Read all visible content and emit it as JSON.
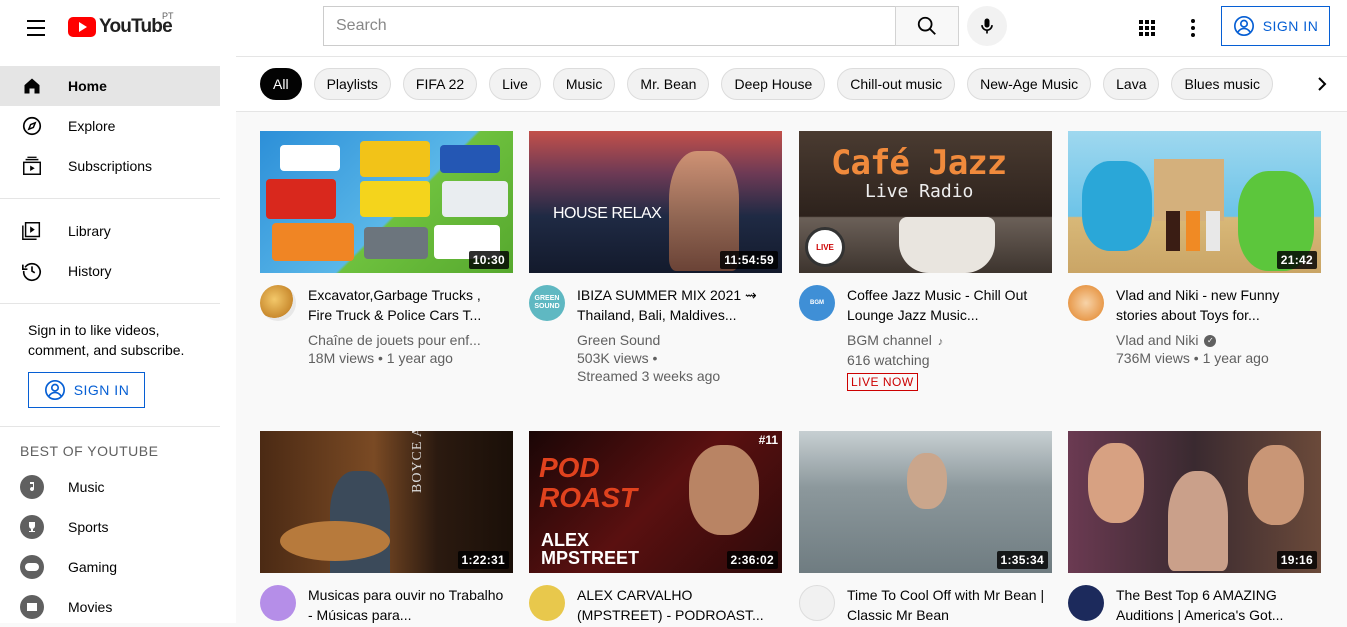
{
  "header": {
    "logo_text": "YouTube",
    "country_code": "PT",
    "search_placeholder": "Search",
    "signin_label": "SIGN IN"
  },
  "sidebar": {
    "primary": [
      {
        "label": "Home",
        "icon": "home-icon"
      },
      {
        "label": "Explore",
        "icon": "compass-icon"
      },
      {
        "label": "Subscriptions",
        "icon": "subscriptions-icon"
      }
    ],
    "secondary": [
      {
        "label": "Library",
        "icon": "library-icon"
      },
      {
        "label": "History",
        "icon": "history-icon"
      }
    ],
    "signin_prompt": "Sign in to like videos, comment, and subscribe.",
    "signin_label": "SIGN IN",
    "best_of_title": "BEST OF YOUTUBE",
    "best_of": [
      {
        "label": "Music",
        "icon": "music-icon"
      },
      {
        "label": "Sports",
        "icon": "trophy-icon"
      },
      {
        "label": "Gaming",
        "icon": "gamepad-icon"
      },
      {
        "label": "Movies",
        "icon": "film-icon"
      }
    ]
  },
  "chips": [
    "All",
    "Playlists",
    "FIFA 22",
    "Live",
    "Music",
    "Mr. Bean",
    "Deep House",
    "Chill-out music",
    "New-Age Music",
    "Lava",
    "Blues music"
  ],
  "videos": [
    {
      "title": "Excavator,Garbage Trucks , Fire Truck & Police Cars T...",
      "channel": "Chaîne de jouets pour enf...",
      "stats": "18M views • 1 year ago",
      "duration": "10:30",
      "thumb_color": "#3a9ad9"
    },
    {
      "title": "IBIZA SUMMER MIX 2021 ⇝ Thailand, Bali, Maldives...",
      "channel": "Green Sound",
      "stats": "503K views •",
      "stats2": "Streamed 3 weeks ago",
      "duration": "11:54:59",
      "thumb_text": "HOUSE RELAX",
      "thumb_color": "#1f2a44"
    },
    {
      "title": "Coffee Jazz Music - Chill Out Lounge Jazz Music...",
      "channel": "BGM channel",
      "stats": "616 watching",
      "live": "LIVE NOW",
      "thumb_text": "Café Jazz",
      "thumb_text2": "Live Radio",
      "thumb_color": "#3b2d25"
    },
    {
      "title": "Vlad and Niki - new Funny stories about Toys for...",
      "channel": "Vlad and Niki",
      "stats": "736M views • 1 year ago",
      "duration": "21:42",
      "thumb_color": "#6cc3e8"
    },
    {
      "title": "Musicas para ouvir no Trabalho - Músicas para...",
      "duration": "1:22:31",
      "thumb_text": "BOYCE AVENUE",
      "thumb_color": "#2b1a10"
    },
    {
      "title": "ALEX CARVALHO (MPSTREET) - PODROAST...",
      "duration": "2:36:02",
      "thumb_text": "POD ROAST",
      "thumb_text2": "ALEX MPSTREET",
      "thumb_tag": "#11",
      "thumb_color": "#3a0d0d"
    },
    {
      "title": "Time To Cool Off with Mr Bean | Classic Mr Bean",
      "duration": "1:35:34",
      "thumb_color": "#7d8a8f"
    },
    {
      "title": "The Best Top 6 AMAZING Auditions | America's Got...",
      "duration": "19:16",
      "thumb_color": "#4a3040"
    }
  ],
  "colors": {
    "accent_blue": "#065fd4",
    "live_red": "#cc0000",
    "brand_red": "#ff0000"
  }
}
